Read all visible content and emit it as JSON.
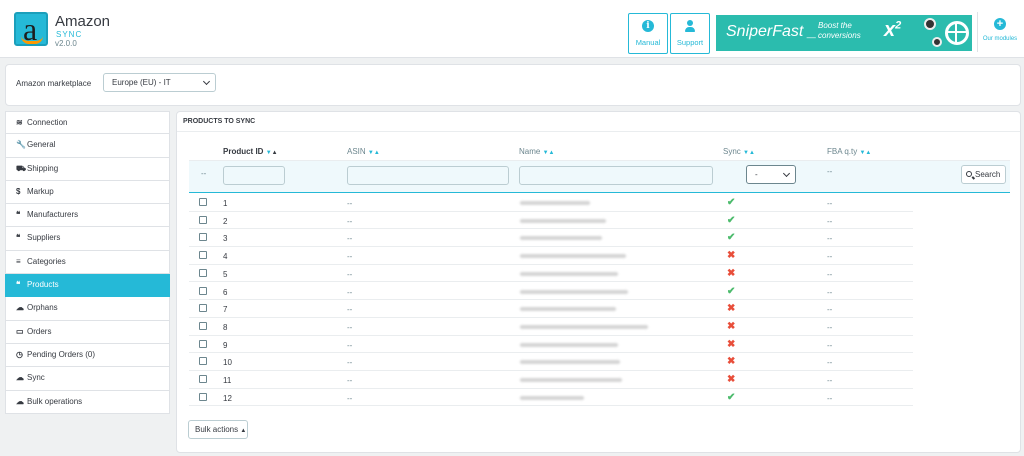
{
  "app": {
    "name": "Amazon",
    "subtitle": "SYNC",
    "version": "v2.0.0",
    "logo_letter": "a"
  },
  "header_buttons": [
    {
      "label": "Manual",
      "icon": "info-icon"
    },
    {
      "label": "Support",
      "icon": "user-icon"
    }
  ],
  "banner": {
    "title": "SniperFast _",
    "tagline": "Boost the conversions",
    "multiplier": "x",
    "exponent": "2"
  },
  "modules": {
    "label": "Our modules",
    "icon": "plus-circle-icon"
  },
  "marketplace": {
    "label": "Amazon marketplace",
    "selected": "Europe (EU) - IT"
  },
  "sidebar": {
    "items": [
      {
        "label": "Connection",
        "icon": "wifi-icon",
        "glyph": "≋"
      },
      {
        "label": "General",
        "icon": "wrench-icon",
        "glyph": "🔧"
      },
      {
        "label": "Shipping",
        "icon": "truck-icon",
        "glyph": "⛟"
      },
      {
        "label": "Markup",
        "icon": "dollar-icon",
        "glyph": "$"
      },
      {
        "label": "Manufacturers",
        "icon": "quote-icon",
        "glyph": "❝"
      },
      {
        "label": "Suppliers",
        "icon": "quote-icon",
        "glyph": "❝"
      },
      {
        "label": "Categories",
        "icon": "list-icon",
        "glyph": "≡"
      },
      {
        "label": "Products",
        "icon": "quote-icon",
        "glyph": "❝"
      },
      {
        "label": "Orphans",
        "icon": "cloud-icon",
        "glyph": "☁"
      },
      {
        "label": "Orders",
        "icon": "credit-card-icon",
        "glyph": "▭"
      },
      {
        "label": "Pending Orders (0)",
        "icon": "clock-icon",
        "glyph": "◷"
      },
      {
        "label": "Sync",
        "icon": "cloud-upload-icon",
        "glyph": "☁"
      },
      {
        "label": "Bulk operations",
        "icon": "cloud-upload-icon",
        "glyph": "☁"
      }
    ],
    "active_index": 7
  },
  "products": {
    "panel_title": "PRODUCTS TO SYNC",
    "columns": {
      "product_id": "Product ID",
      "asin": "ASIN",
      "name": "Name",
      "sync": "Sync",
      "fba": "FBA q.ty"
    },
    "filter": {
      "dash": "--",
      "sync_selected": "-",
      "fba": "--",
      "search_label": "Search"
    },
    "rows": [
      {
        "id": "1",
        "asin": "--",
        "sync": true,
        "fba": "--"
      },
      {
        "id": "2",
        "asin": "--",
        "sync": true,
        "fba": "--"
      },
      {
        "id": "3",
        "asin": "--",
        "sync": true,
        "fba": "--"
      },
      {
        "id": "4",
        "asin": "--",
        "sync": false,
        "fba": "--"
      },
      {
        "id": "5",
        "asin": "--",
        "sync": false,
        "fba": "--"
      },
      {
        "id": "6",
        "asin": "--",
        "sync": true,
        "fba": "--"
      },
      {
        "id": "7",
        "asin": "--",
        "sync": false,
        "fba": "--"
      },
      {
        "id": "8",
        "asin": "--",
        "sync": false,
        "fba": "--"
      },
      {
        "id": "9",
        "asin": "--",
        "sync": false,
        "fba": "--"
      },
      {
        "id": "10",
        "asin": "--",
        "sync": false,
        "fba": "--"
      },
      {
        "id": "11",
        "asin": "--",
        "sync": false,
        "fba": "--"
      },
      {
        "id": "12",
        "asin": "--",
        "sync": true,
        "fba": "--"
      }
    ],
    "bulk_actions": "Bulk actions"
  },
  "colors": {
    "accent": "#25b9d7",
    "success": "#4cbb6c",
    "danger": "#e84e3a",
    "banner": "#2bbcae"
  }
}
